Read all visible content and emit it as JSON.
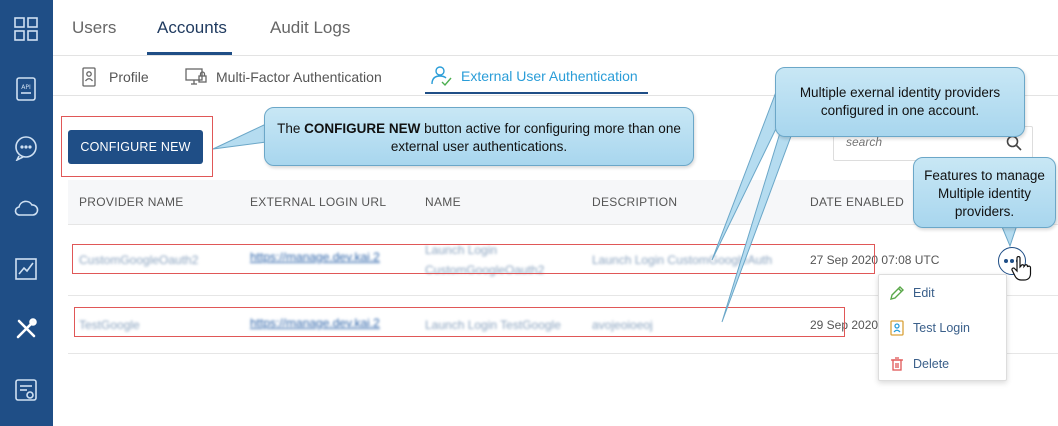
{
  "nav": {
    "top_tabs": [
      {
        "label": "Users"
      },
      {
        "label": "Accounts"
      },
      {
        "label": "Audit Logs"
      }
    ],
    "sub_tabs": [
      {
        "label": "Profile"
      },
      {
        "label": "Multi-Factor Authentication"
      },
      {
        "label": "External User Authentication"
      }
    ],
    "rail_icons": [
      "dashboard-icon",
      "api-icon",
      "chat-icon",
      "cloud-icon",
      "chart-icon",
      "tools-icon",
      "billing-icon"
    ]
  },
  "toolbar": {
    "configure_label": "CONFIGURE NEW",
    "search_placeholder": "search"
  },
  "table": {
    "headers": {
      "provider_name": "PROVIDER NAME",
      "external_login_url": "EXTERNAL LOGIN URL",
      "name": "NAME",
      "description": "DESCRIPTION",
      "date_enabled": "DATE ENABLED"
    },
    "rows": [
      {
        "provider_name": "CustomGoogleOauth2",
        "url": "https://manage.dev.kai.2",
        "name_line1": "Launch Login",
        "name_line2": "CustomGoogleOauth2",
        "description": "Launch Login CustomGoogleAuth",
        "date": "27 Sep 2020 07:08 UTC"
      },
      {
        "provider_name": "TestGoogle",
        "url": "https://manage.dev.kai.2",
        "name_line1": "Launch Login TestGoogle",
        "description": "avojeoioeoj",
        "date": "29 Sep 2020"
      }
    ]
  },
  "row_menu": {
    "items": [
      {
        "label": "Edit"
      },
      {
        "label": "Test Login"
      },
      {
        "label": "Delete"
      }
    ]
  },
  "callouts": {
    "configure_pre": "The ",
    "configure_bold": "CONFIGURE NEW",
    "configure_post": " button active for configuring more than one external user authentications.",
    "providers": "Multiple exernal identity providers configured in one account.",
    "features": "Features to manage Multiple identity providers."
  },
  "colors": {
    "rail": "#1f4e86",
    "accent": "#2a9dd8",
    "callout": "#b5dcf0",
    "highlight": "#e05757"
  }
}
